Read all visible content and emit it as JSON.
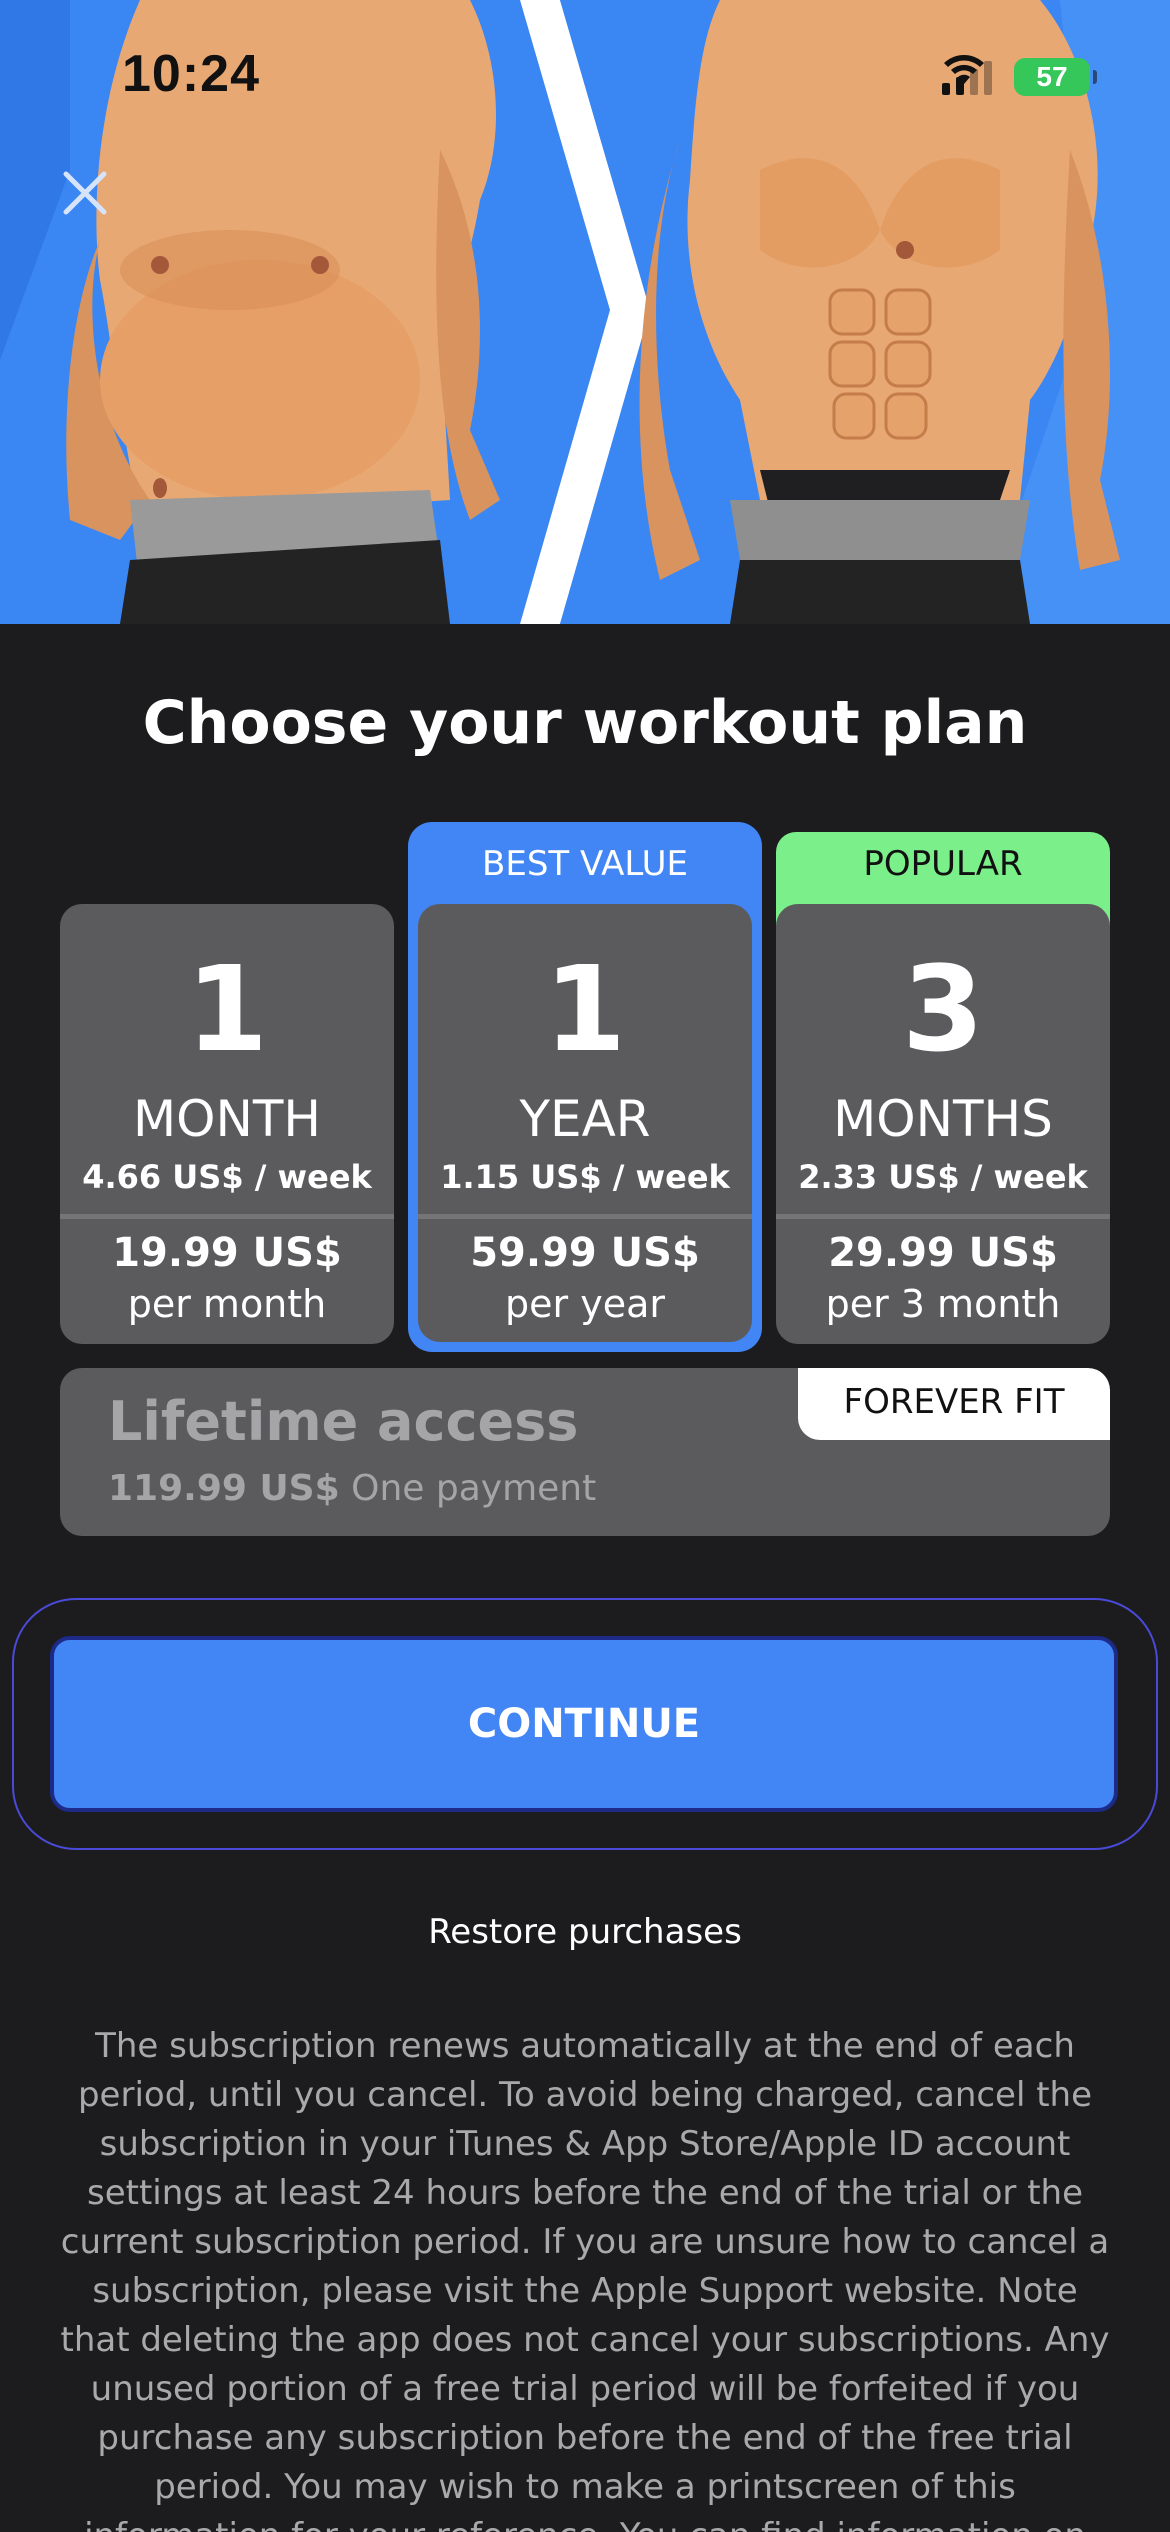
{
  "status_bar": {
    "time": "10:24",
    "battery": "57"
  },
  "title": "Choose your workout plan",
  "plans": [
    {
      "badge": "",
      "number": "1",
      "unit": "MONTH",
      "per_week": "4.66 US$ / week",
      "price": "19.99 US$",
      "period": "per month",
      "selected": false
    },
    {
      "badge": "BEST VALUE",
      "number": "1",
      "unit": "YEAR",
      "per_week": "1.15 US$ / week",
      "price": "59.99 US$",
      "period": "per year",
      "selected": true
    },
    {
      "badge": "POPULAR",
      "number": "3",
      "unit": "MONTHS",
      "per_week": "2.33 US$ / week",
      "price": "29.99 US$",
      "period": "per 3 month",
      "selected": false
    }
  ],
  "lifetime": {
    "title": "Lifetime access",
    "price": "119.99 US$",
    "note": "One payment",
    "badge": "FOREVER FIT"
  },
  "continue_label": "CONTINUE",
  "restore_label": "Restore purchases",
  "terms": "The subscription renews automatically at the end of each period, until you cancel. To avoid being charged, cancel the subscription in your iTunes & App Store/Apple ID account settings at least 24 hours before the end of the trial or the current subscription period. If you are unsure how to cancel a subscription, please visit the Apple Support website. Note that deleting the app does not cancel your subscriptions. Any unused portion of a free trial period will be forfeited if you purchase any subscription before the end of the free trial period. You may wish to make a printscreen of this information for your reference. You can find information on your subscription",
  "colors": {
    "hero_blue": "#3a86f2",
    "accent_blue": "#4285f4",
    "popular_green": "#7bf08a",
    "card_gray": "#5b5b5d",
    "background": "#1c1c1e"
  },
  "icons": {
    "close": "close-icon",
    "wifi": "wifi-icon",
    "signal": "cellular-signal-icon",
    "battery": "battery-icon"
  }
}
